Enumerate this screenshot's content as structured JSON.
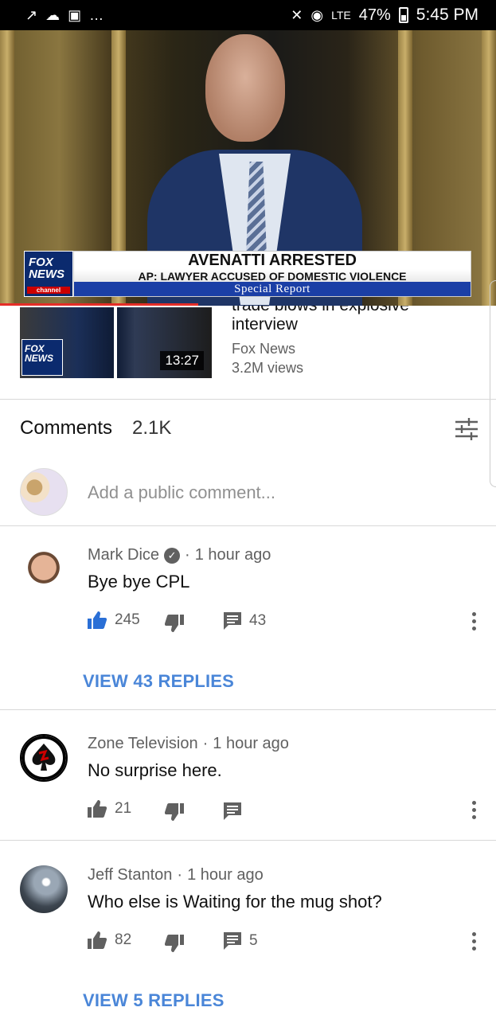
{
  "status_bar": {
    "battery": "47%",
    "time": "5:45 PM",
    "network": "LTE"
  },
  "video": {
    "channel_logo": "FOX NEWS",
    "channel_logo_sub": "channel",
    "headline": "AVENATTI ARRESTED",
    "subheadline": "AP: LAWYER ACCUSED OF DOMESTIC VIOLENCE",
    "banner": "Special Report",
    "progress_fraction": 0.4
  },
  "related": {
    "title_cut": "trade blows in explosive",
    "title": "interview",
    "channel": "Fox News",
    "views": "3.2M views",
    "duration": "13:27",
    "thumb_logo": "FOX NEWS"
  },
  "comments": {
    "title": "Comments",
    "count": "2.1K",
    "add_placeholder": "Add a public comment...",
    "threads": [
      {
        "author": "Mark Dice",
        "verified": true,
        "time": "1 hour ago",
        "text": "Bye bye CPL",
        "likes": "245",
        "replies_count": "43",
        "liked": true,
        "view_replies": "VIEW 43 REPLIES"
      },
      {
        "author": "Zone Television",
        "verified": false,
        "time": "1 hour ago",
        "text": "No surprise here.",
        "likes": "21",
        "replies_count": "",
        "liked": false,
        "view_replies": ""
      },
      {
        "author": "Jeff Stanton",
        "verified": false,
        "time": "1 hour ago",
        "text": "Who else is Waiting for the mug shot?",
        "likes": "82",
        "replies_count": "5",
        "liked": false,
        "view_replies": "VIEW 5 REPLIES"
      }
    ]
  },
  "colors": {
    "accent_blue": "#4a86d8",
    "like_active": "#2a6fd6",
    "progress_red": "#e52d27"
  }
}
